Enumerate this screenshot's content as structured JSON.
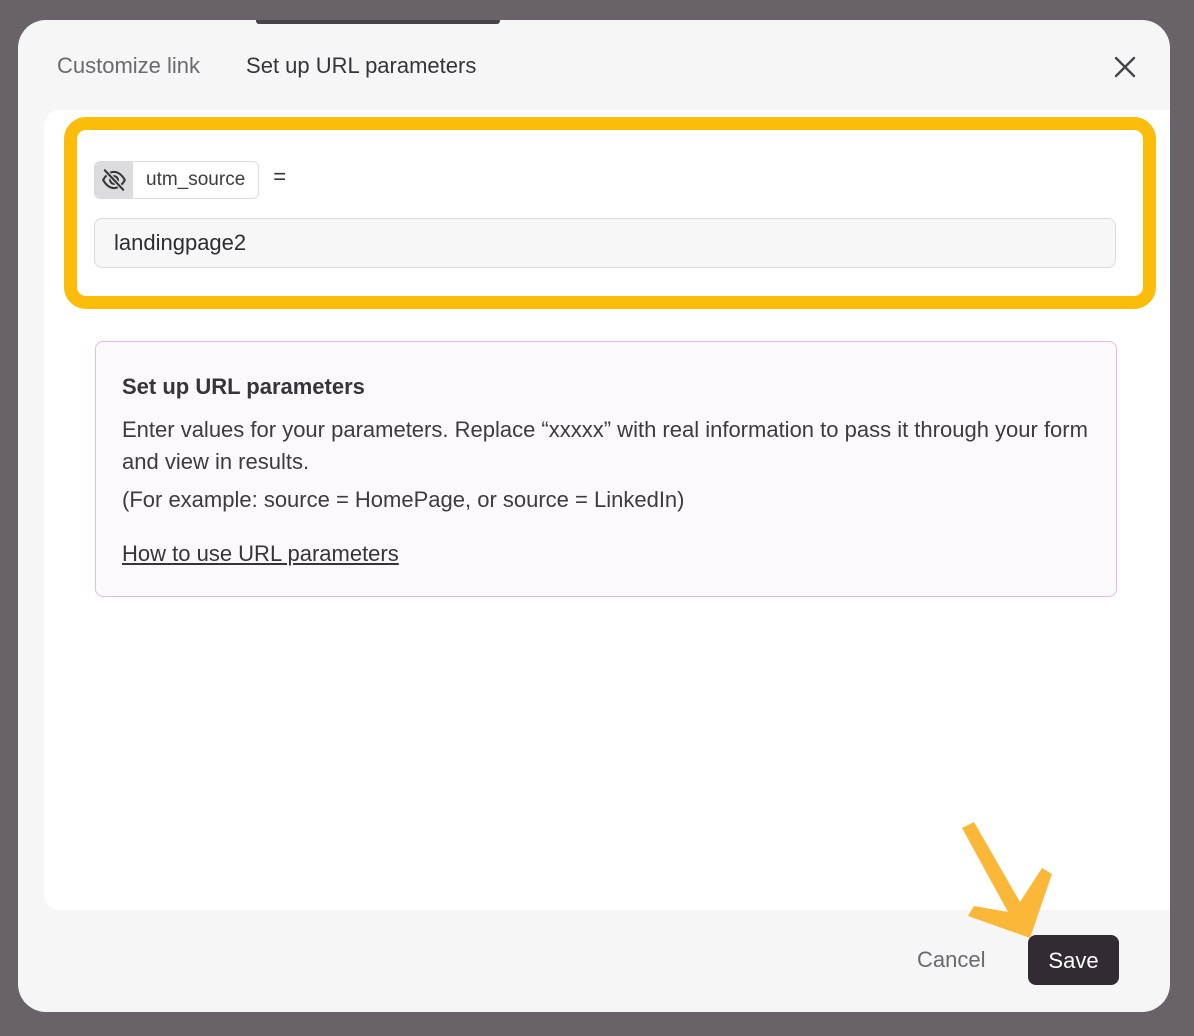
{
  "tabs": [
    {
      "label": "Customize link",
      "active": false
    },
    {
      "label": "Set up URL parameters",
      "active": true
    }
  ],
  "parameter": {
    "name": "utm_source",
    "equals": "=",
    "value": "landingpage2",
    "visibility_icon": "eye-off-icon"
  },
  "info": {
    "title": "Set up URL parameters",
    "body": "Enter values for your parameters. Replace “xxxxx” with real information to pass it through your form and view in results.",
    "example": "(For example: source = HomePage, or source = LinkedIn)",
    "link": "How to use URL parameters"
  },
  "footer": {
    "cancel_label": "Cancel",
    "save_label": "Save"
  },
  "colors": {
    "highlight": "#fcbc0a",
    "save_button": "#332b34",
    "info_border": "#e9b8ea",
    "arrow": "#fbb838"
  },
  "icons": {
    "close": "close-icon",
    "annotation": "arrow-annotation-icon"
  }
}
